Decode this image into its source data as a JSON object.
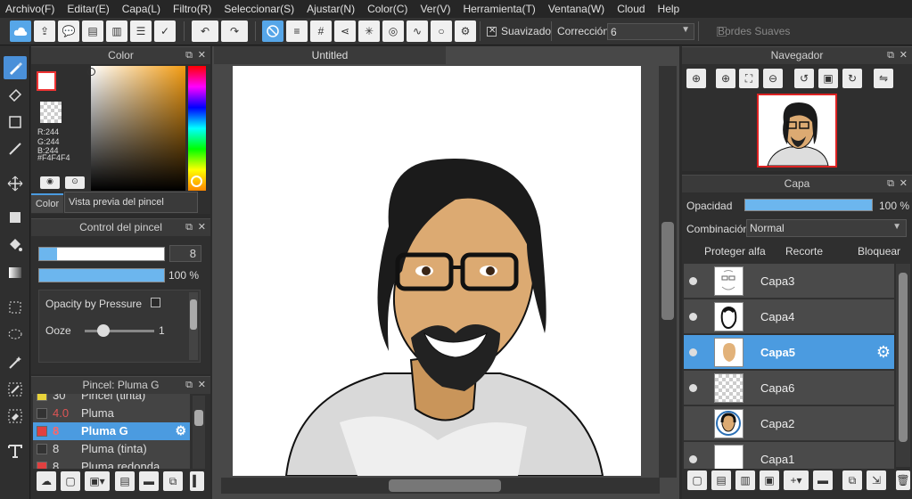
{
  "menu": [
    "Archivo(F)",
    "Editar(E)",
    "Capa(L)",
    "Filtro(R)",
    "Seleccionar(S)",
    "Ajustar(N)",
    "Color(C)",
    "Ver(V)",
    "Herramienta(T)",
    "Ventana(W)",
    "Cloud",
    "Help"
  ],
  "toolbar": {
    "smoothing_label": "Suavizado",
    "correction_label": "Corrección",
    "correction_value": "6",
    "soft_edges_label": "Bordes Suaves"
  },
  "color_panel": {
    "title": "Color",
    "r": "R:244",
    "g": "G:244",
    "b": "B:244",
    "hex": "#F4F4F4",
    "tab_color": "Color",
    "tab_preview": "Vista previa del pincel"
  },
  "brush_control": {
    "title": "Control del pincel",
    "size": "8",
    "opacity": "100 %",
    "opacity_by_pressure": "Opacity by Pressure",
    "ooze_label": "Ooze",
    "ooze_value": "1"
  },
  "brush_list": {
    "title": "Pincel: Pluma G",
    "items": [
      {
        "size": "30",
        "name": "Pincel (tinta)",
        "color": "#e8d33a"
      },
      {
        "size": "4.0",
        "name": "Pluma",
        "color": "#333333"
      },
      {
        "size": "8",
        "name": "Pluma G",
        "color": "#e04040"
      },
      {
        "size": "8",
        "name": "Pluma (tinta)",
        "color": "#333333"
      },
      {
        "size": "8",
        "name": "Pluma redonda",
        "color": "#e04040"
      }
    ]
  },
  "canvas": {
    "tab_title": "Untitled"
  },
  "navigator": {
    "title": "Navegador"
  },
  "layers": {
    "title": "Capa",
    "opacity_label": "Opacidad",
    "opacity_value": "100 %",
    "blend_label": "Combinación",
    "blend_value": "Normal",
    "protect_alpha": "Proteger alfa",
    "clip": "Recorte",
    "lock": "Bloquear",
    "items": [
      {
        "name": "Capa3"
      },
      {
        "name": "Capa4"
      },
      {
        "name": "Capa5"
      },
      {
        "name": "Capa6"
      },
      {
        "name": "Capa2"
      },
      {
        "name": "Capa1"
      }
    ]
  }
}
